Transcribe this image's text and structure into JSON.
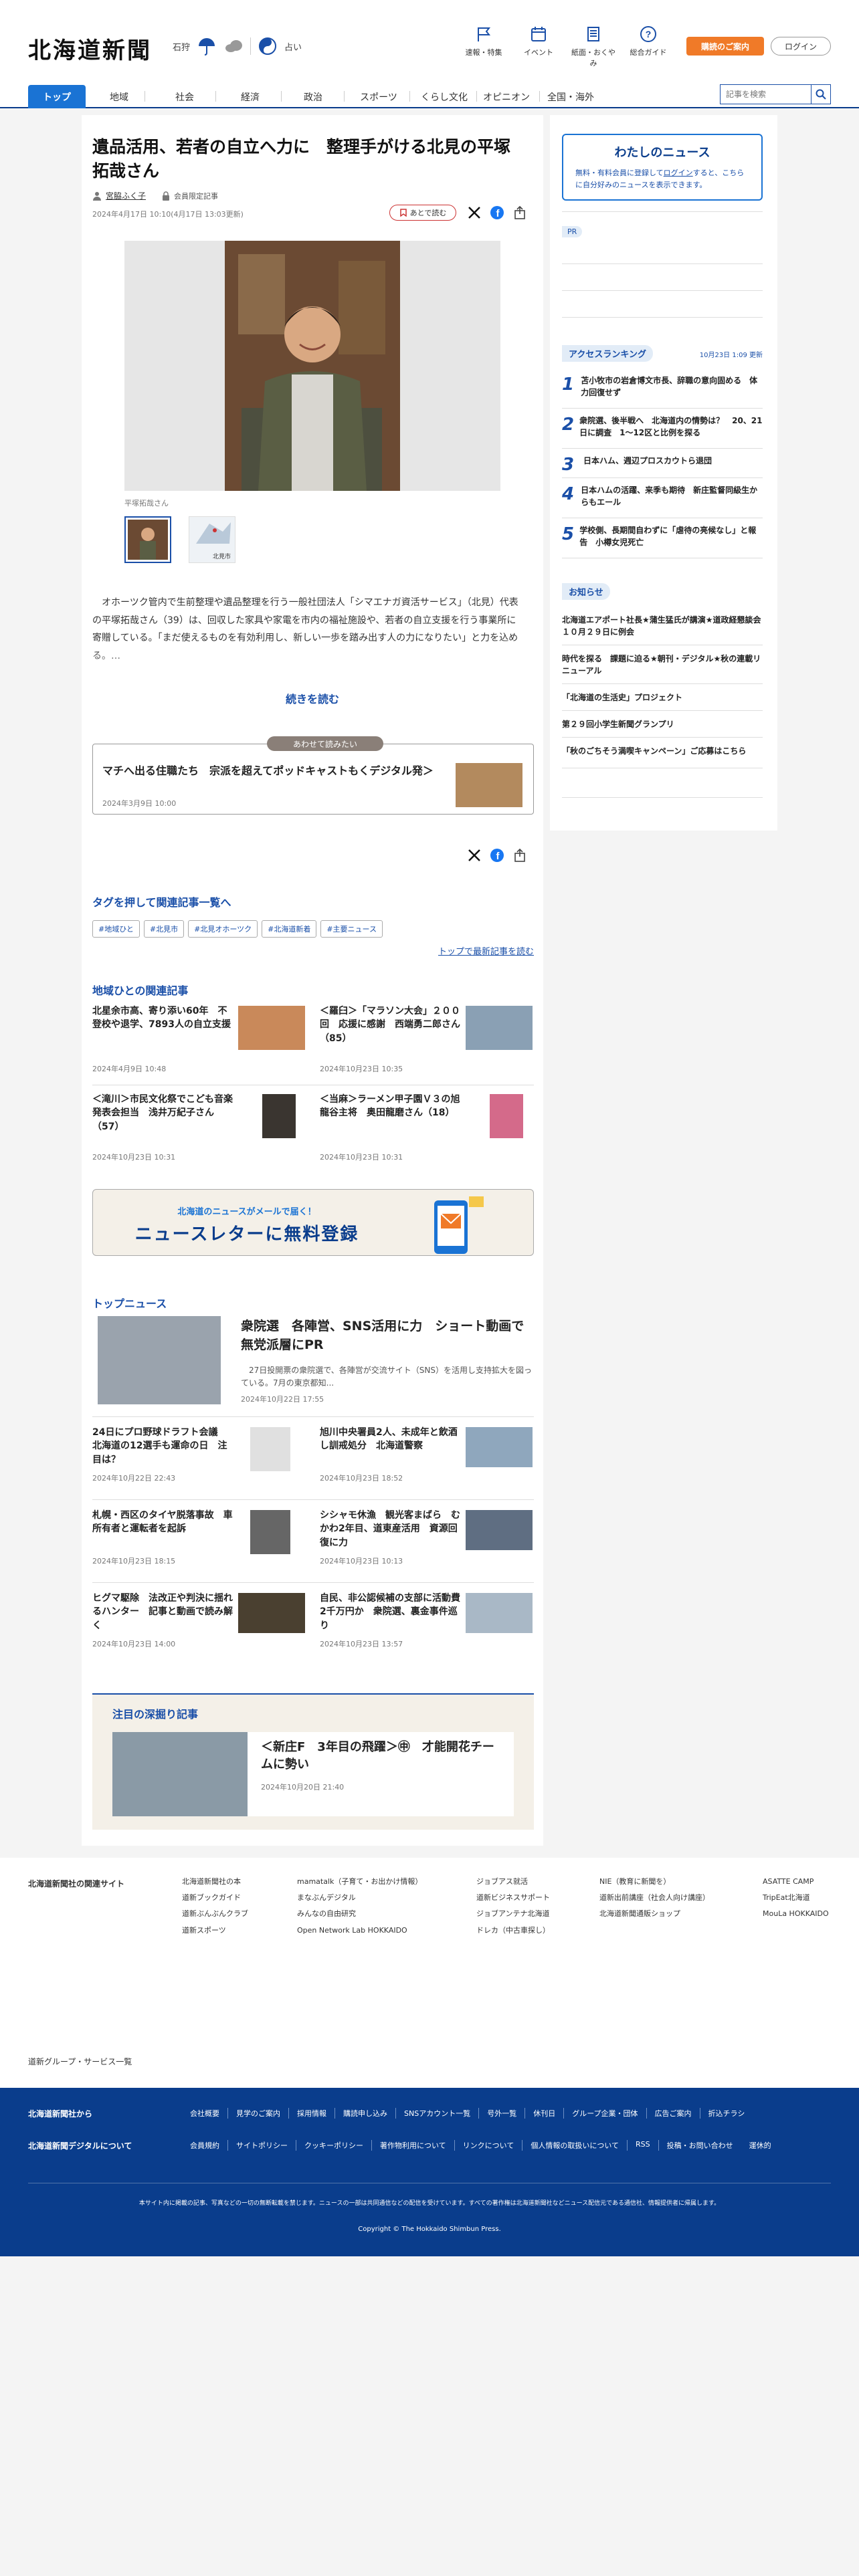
{
  "header": {
    "logo": "北海道新聞",
    "weather_region": "石狩",
    "fortune_label": "占い",
    "nav": [
      {
        "label": "速報・特集",
        "icon": "flag-icon"
      },
      {
        "label": "イベント",
        "icon": "calendar-icon"
      },
      {
        "label": "紙面・おくやみ",
        "icon": "newspaper-icon"
      },
      {
        "label": "総合ガイド",
        "icon": "question-icon"
      }
    ],
    "btn_subscribe": "購読のご案内",
    "btn_login": "ログイン"
  },
  "categories": [
    "トップ",
    "地域",
    "社会",
    "経済",
    "政治",
    "スポーツ",
    "くらし文化",
    "オピニオン",
    "全国・海外"
  ],
  "search": {
    "placeholder": "記事を検索"
  },
  "article": {
    "title": "遺品活用、若者の自立へ力に　整理手がける北見の平塚拓哉さん",
    "author": "宮脇ふく子",
    "member_label": "会員限定記事",
    "dates": "2024年4月17日 10:10(4月17日 13:03更新)",
    "read_later": "あとで読む",
    "caption": "平塚拓哉さん",
    "thumb2_label": "北見市",
    "body": "　オホーツク管内で生前整理や遺品整理を行う一般社団法人「シマエナガ資活サービス」（北見）代表の平塚拓哉さん（39）は、回収した家具や家電を市内の福祉施設や、若者の自立支援を行う事業所に寄贈している。「まだ使えるものを有効利用し、新しい一歩を踏み出す人の力になりたい」と力を込める。…",
    "read_more": "続きを読む"
  },
  "related": {
    "tag": "あわせて読みたい",
    "title": "マチへ出る住職たち　宗派を超えてポッドキャストもくデジタル発＞",
    "date": "2024年3月9日 10:00"
  },
  "tags": {
    "heading": "タグを押して関連記事一覧へ",
    "items": [
      "#地域ひと",
      "#北見市",
      "#北見オホーツク",
      "#北海道新着",
      "#主要ニュース"
    ],
    "latest_link": "トップで最新記事を読む"
  },
  "local": {
    "heading": "地域ひとの関連記事",
    "items": [
      {
        "title": "北星余市高、寄り添い60年　不登校や退学、7893人の自立支援",
        "date": "2024年4月9日 10:48"
      },
      {
        "title": "＜羅臼＞「マラソン大会」２００回　応援に感謝　西端勇二郎さん（85）",
        "date": "2024年10月23日 10:35"
      },
      {
        "title": "＜滝川＞市民文化祭でこども音楽発表会担当　浅井万紀子さん（57）",
        "date": "2024年10月23日 10:31"
      },
      {
        "title": "＜当麻＞ラーメン甲子園Ｖ３の旭龍谷主将　奥田龍磨さん（18）",
        "date": "2024年10月23日 10:31"
      }
    ]
  },
  "newsletter": {
    "small": "北海道のニュースがメールで届く！",
    "big": "ニュースレターに無料登録"
  },
  "top_news": {
    "heading": "トップニュース",
    "lead": {
      "title": "衆院選　各陣営、SNS活用に力　ショート動画で無党派層にPR",
      "summary": "　27日投開票の衆院選で、各陣営が交流サイト（SNS）を活用し支持拡大を図っている。7月の東京都知...",
      "date": "2024年10月22日 17:55"
    },
    "items": [
      {
        "title": "24日にプロ野球ドラフト会議　北海道の12選手も運命の日　注目は？",
        "date": "2024年10月22日 22:43"
      },
      {
        "title": "旭川中央署員2人、未成年と飲酒し訓戒処分　北海道警察",
        "date": "2024年10月23日 18:52"
      },
      {
        "title": "札幌・西区のタイヤ脱落事故　車所有者と運転者を起訴",
        "date": "2024年10月23日 18:15"
      },
      {
        "title": "シシャモ休漁　観光客まばら　むかわ2年目、道東産活用　資源回復に力",
        "date": "2024年10月23日 10:13"
      },
      {
        "title": "ヒグマ駆除　法改正や判決に揺れるハンター　記事と動画で読み解く",
        "date": "2024年10月23日 14:00"
      },
      {
        "title": "自民、非公認候補の支部に活動費　2千万円か　衆院選、裏金事件巡り",
        "date": "2024年10月23日 13:57"
      }
    ]
  },
  "deep": {
    "heading": "注目の深掘り記事",
    "title": "＜新庄F　3年目の飛躍＞㊥　才能開花チームに勢い",
    "date": "2024年10月20日 21:40"
  },
  "sidebar": {
    "my_news_title": "わたしのニュース",
    "my_news_text_1": "無料・有料会員に登録して",
    "my_news_link": "ログイン",
    "my_news_text_2": "すると、こちらに自分好みのニュースを表示できます。",
    "pr_label": "PR",
    "ranking_title": "アクセスランキング",
    "ranking_updated": "10月23日 1:09 更新",
    "ranking": [
      "苫小牧市の岩倉博文市長、辞職の意向固める　体力回復せず",
      "衆院選、後半戦へ　北海道内の情勢は？　20、21日に調査　1～12区と比例を探る",
      "日本ハム、週辺プロスカウトら退団",
      "日本ハムの活躍、来季も期待　新庄監督同級生からもエール",
      "学校側、長期間自わずに「虐待の亮候なし」と報告　小樽女児死亡"
    ],
    "notice_title": "お知らせ",
    "notices": [
      "北海道エアポート社長★蒲生猛氏が講演★道政経懇談会１０月２９日に例会",
      "時代を探る　課題に迫る★朝刊・デジタル★秋の連載リニューアル",
      "「北海道の生活史」プロジェクト",
      "第２９回小学生新聞グランプリ",
      "「秋のごちそう満喫キャンペーン」ご応募はこちら"
    ]
  },
  "footer": {
    "group_link": "道新グループ・サービス一覧",
    "related_sites_label": "北海道新聞社の関連サイト",
    "sites": [
      [
        "北海道新聞社の本",
        "道新ブックガイド",
        "道新ぶんぶんクラブ",
        "道新スポーツ"
      ],
      [
        "mamatalk（子育て・お出かけ情報）",
        "まなぶんデジタル",
        "みんなの自由研究",
        "Open Network Lab HOKKAIDO"
      ],
      [
        "ジョブアス就活",
        "道新ビジネスサポート",
        "ジョブアンテナ北海道",
        "ドレカ（中古車探し）"
      ],
      [
        "NIE（教育に新聞を）",
        "道新出前講座（社会人向け講座）",
        "北海道新聞通販ショップ"
      ],
      [
        "ASATTE CAMP",
        "TripEat北海道",
        "MouLa HOKKAIDO"
      ]
    ],
    "from_company": "北海道新聞社から",
    "about_digital": "北海道新聞デジタルについて",
    "links1": [
      "会社概要",
      "見学のご案内",
      "採用情報",
      "購読申し込み",
      "SNSアカウント一覧",
      "号外一覧",
      "休刊日",
      "グループ企業・団体",
      "広告ご案内",
      "折込チラシ"
    ],
    "links2": [
      "会員規約",
      "サイトポリシー",
      "クッキーポリシー",
      "著作物利用について",
      "リンクについて",
      "個人情報の取扱いについて",
      "RSS",
      "投稿・お問い合わせ",
      "運休的"
    ],
    "notice": "本サイト内に掲載の記事、写真などの一切の無断転載を禁じます。ニュースの一部は共同通信などの配信を受けています。すべての著作権は北海道新聞社などニュース配信元である通信社、情報提供者に帰属します。",
    "copyright": "Copyright © The Hokkaido Shimbun Press."
  },
  "colors": {
    "brand_blue": "#0a3d8c",
    "accent_blue": "#1a73d4",
    "orange": "#f07a28"
  }
}
